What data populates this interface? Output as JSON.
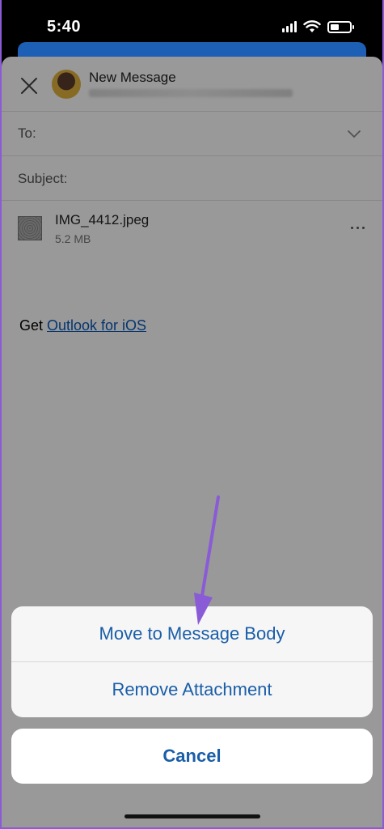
{
  "status_bar": {
    "time": "5:40"
  },
  "compose": {
    "title": "New Message",
    "to_label": "To:",
    "subject_label": "Subject:",
    "attachment": {
      "name": "IMG_4412.jpeg",
      "size": "5.2 MB"
    },
    "signature_prefix": "Get ",
    "signature_link": "Outlook for iOS"
  },
  "action_sheet": {
    "items": [
      "Move to Message Body",
      "Remove Attachment"
    ],
    "cancel": "Cancel"
  },
  "colors": {
    "action_text": "#1a5ea8",
    "arrow": "#8a5bd6",
    "link": "#0b59b8"
  },
  "icons": [
    "close-icon",
    "chevron-down-icon",
    "more-icon",
    "signal-icon",
    "wifi-icon",
    "battery-icon"
  ]
}
